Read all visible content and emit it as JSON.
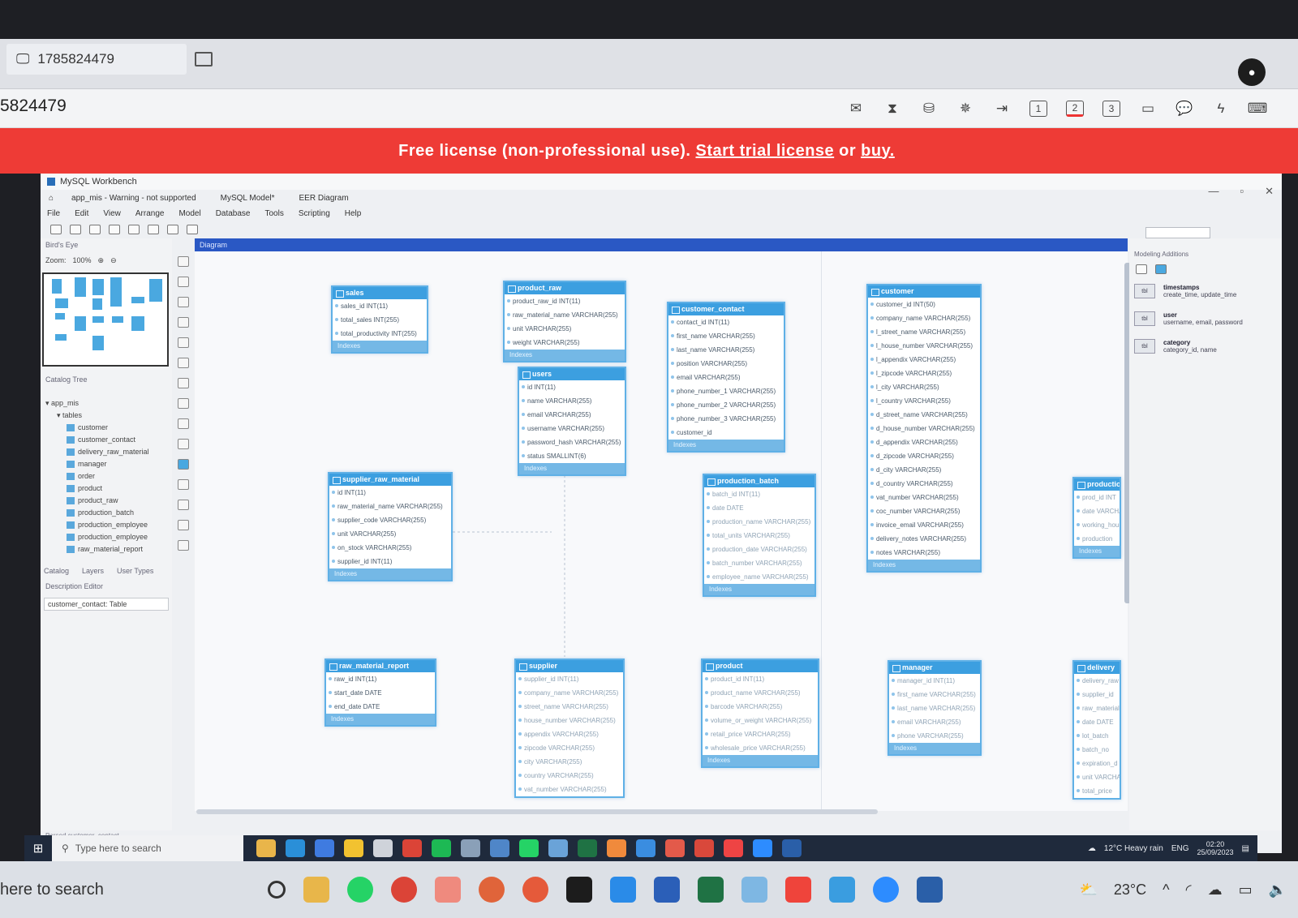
{
  "remote": {
    "tab_label": "1785824479",
    "id_label": "5824479",
    "tool_nums": [
      "1",
      "2",
      "3"
    ]
  },
  "banner": {
    "prefix": "Free license (non-professional use).",
    "trial_link": "Start trial license",
    "connector": "or",
    "buy_link": "buy."
  },
  "workbench": {
    "title": "MySQL Workbench",
    "tabs": [
      "app_mis - Warning - not supported",
      "MySQL Model*",
      "EER Diagram"
    ],
    "menu": [
      "File",
      "Edit",
      "View",
      "Arrange",
      "Model",
      "Database",
      "Tools",
      "Scripting",
      "Help"
    ],
    "left": {
      "bird_eye": "Bird's Eye",
      "zoom_label": "Zoom:",
      "zoom_value": "100%",
      "catalog_tree": "Catalog Tree",
      "schema": "app_mis",
      "tables_node": "tables",
      "tables": [
        "customer",
        "customer_contact",
        "delivery_raw_material",
        "manager",
        "order",
        "product",
        "product_raw",
        "production_batch",
        "production_employee",
        "production_employee",
        "raw_material_report"
      ],
      "tabs": [
        "Catalog",
        "Layers",
        "User Types"
      ],
      "description_editor": "Description Editor",
      "combo_value": "customer_contact: Table"
    },
    "canvas_title": "Diagram",
    "right": {
      "head": "Modeling Additions",
      "items": [
        {
          "icon": "tbl",
          "title": "timestamps",
          "desc": "create_time, update_time"
        },
        {
          "icon": "tbl",
          "title": "user",
          "desc": "username, email, password"
        },
        {
          "icon": "tbl",
          "title": "category",
          "desc": "category_id, name"
        }
      ]
    },
    "status": "Parsed customer_contact"
  },
  "entities": [
    {
      "name": "sales",
      "fields": [
        "sales_id INT(11)",
        "total_sales INT(255)",
        "total_productivity INT(255)"
      ],
      "footer": "Indexes"
    },
    {
      "name": "product_raw",
      "fields": [
        "product_raw_id INT(11)",
        "raw_material_name VARCHAR(255)",
        "unit VARCHAR(255)",
        "weight VARCHAR(255)"
      ],
      "footer": "Indexes"
    },
    {
      "name": "customer_contact",
      "fields": [
        "contact_id INT(11)",
        "first_name VARCHAR(255)",
        "last_name VARCHAR(255)",
        "position VARCHAR(255)",
        "email VARCHAR(255)",
        "phone_number_1 VARCHAR(255)",
        "phone_number_2 VARCHAR(255)",
        "phone_number_3 VARCHAR(255)",
        "customer_id"
      ],
      "footer": "Indexes"
    },
    {
      "name": "customer",
      "fields": [
        "customer_id INT(50)",
        "company_name VARCHAR(255)",
        "l_street_name VARCHAR(255)",
        "l_house_number VARCHAR(255)",
        "l_appendix VARCHAR(255)",
        "l_zipcode VARCHAR(255)",
        "l_city VARCHAR(255)",
        "l_country VARCHAR(255)",
        "d_street_name VARCHAR(255)",
        "d_house_number VARCHAR(255)",
        "d_appendix VARCHAR(255)",
        "d_zipcode VARCHAR(255)",
        "d_city VARCHAR(255)",
        "d_country VARCHAR(255)",
        "vat_number VARCHAR(255)",
        "coc_number VARCHAR(255)",
        "invoice_email VARCHAR(255)",
        "delivery_notes VARCHAR(255)",
        "notes VARCHAR(255)"
      ],
      "footer": "Indexes"
    },
    {
      "name": "users",
      "fields": [
        "id INT(11)",
        "name VARCHAR(255)",
        "email VARCHAR(255)",
        "username VARCHAR(255)",
        "password_hash VARCHAR(255)",
        "status SMALLINT(6)"
      ],
      "footer": "Indexes"
    },
    {
      "name": "supplier_raw_material",
      "fields": [
        "id INT(11)",
        "raw_material_name VARCHAR(255)",
        "supplier_code VARCHAR(255)",
        "unit VARCHAR(255)",
        "on_stock VARCHAR(255)",
        "supplier_id INT(11)"
      ],
      "footer": "Indexes"
    },
    {
      "name": "production_batch",
      "fields": [
        "batch_id INT(11)",
        "date DATE",
        "production_name VARCHAR(255)",
        "total_units VARCHAR(255)",
        "production_date VARCHAR(255)",
        "batch_number VARCHAR(255)",
        "employee_name VARCHAR(255)"
      ],
      "footer": "Indexes"
    },
    {
      "name": "production",
      "fields": [
        "prod_id INT",
        "date VARCHAR",
        "working_hours",
        "production"
      ],
      "footer": "Indexes"
    },
    {
      "name": "raw_material_report",
      "fields": [
        "raw_id INT(11)",
        "start_date DATE",
        "end_date DATE"
      ],
      "footer": "Indexes"
    },
    {
      "name": "supplier",
      "fields": [
        "supplier_id INT(11)",
        "company_name VARCHAR(255)",
        "street_name VARCHAR(255)",
        "house_number VARCHAR(255)",
        "appendix VARCHAR(255)",
        "zipcode VARCHAR(255)",
        "city VARCHAR(255)",
        "country VARCHAR(255)",
        "vat_number VARCHAR(255)"
      ],
      "footer": ""
    },
    {
      "name": "product",
      "fields": [
        "product_id INT(11)",
        "product_name VARCHAR(255)",
        "barcode VARCHAR(255)",
        "volume_or_weight VARCHAR(255)",
        "retail_price VARCHAR(255)",
        "wholesale_price VARCHAR(255)"
      ],
      "footer": "Indexes"
    },
    {
      "name": "manager",
      "fields": [
        "manager_id INT(11)",
        "first_name VARCHAR(255)",
        "last_name VARCHAR(255)",
        "email VARCHAR(255)",
        "phone VARCHAR(255)"
      ],
      "footer": "Indexes"
    },
    {
      "name": "delivery",
      "fields": [
        "delivery_raw",
        "supplier_id",
        "raw_material",
        "date DATE",
        "lot_batch",
        "batch_no",
        "expiration_d",
        "unit VARCHAR",
        "total_price"
      ],
      "footer": ""
    }
  ],
  "inner_taskbar": {
    "search_placeholder": "Type here to search",
    "weather": "12°C Heavy rain",
    "lang": "ENG",
    "time": "02:20",
    "date": "25/09/2023"
  },
  "host_taskbar": {
    "search_text": "here to search",
    "temperature": "23°C"
  },
  "colors": {
    "banner": "#ee3b36",
    "entity_header": "#3c9fe0",
    "canvas_bar": "#2a58c4"
  }
}
